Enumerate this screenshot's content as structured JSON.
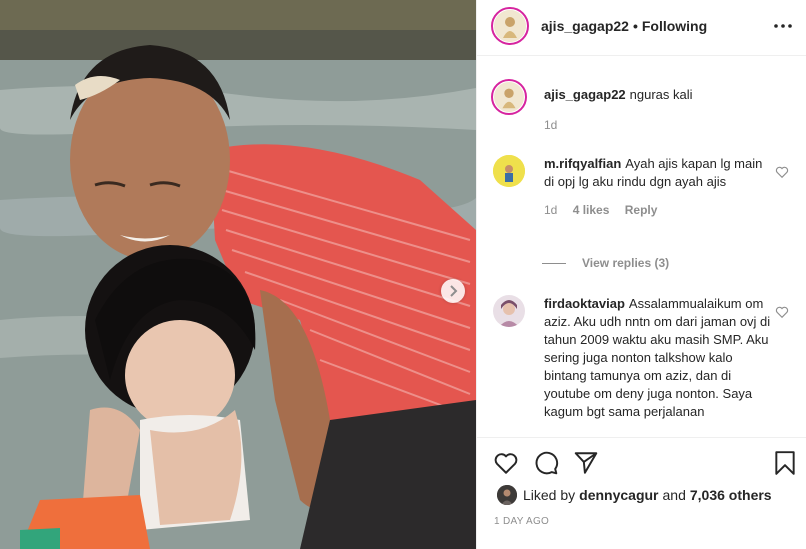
{
  "post": {
    "username": "ajis_gagap22",
    "follow_status": "Following",
    "separator": "•",
    "caption": "nguras kali",
    "caption_time": "1d"
  },
  "comments": [
    {
      "username": "m.rifqyalfian",
      "text": "Ayah ajis kapan lg main di opj lg aku rindu dgn ayah ajis",
      "time": "1d",
      "likes": "4 likes",
      "reply_label": "Reply",
      "view_replies": "View replies (3)"
    },
    {
      "username": "firdaoktaviap",
      "text": "Assalammualaikum om aziz. Aku udh nntn om dari jaman ovj di tahun 2009 waktu aku masih SMP. Aku sering juga nonton talkshow kalo bintang tamunya om aziz, dan di youtube om deny juga nonton. Saya kagum bgt sama perjalanan"
    }
  ],
  "liked_by": {
    "prefix": "Liked by",
    "user": "dennycagur",
    "and_text": "and",
    "others": "7,036 others"
  },
  "time_ago": "1 DAY AGO",
  "icons": {
    "more": "more-horizontal-icon",
    "like": "heart-icon",
    "comment": "comment-icon",
    "share": "send-icon",
    "save": "bookmark-icon",
    "next": "chevron-right-icon"
  }
}
